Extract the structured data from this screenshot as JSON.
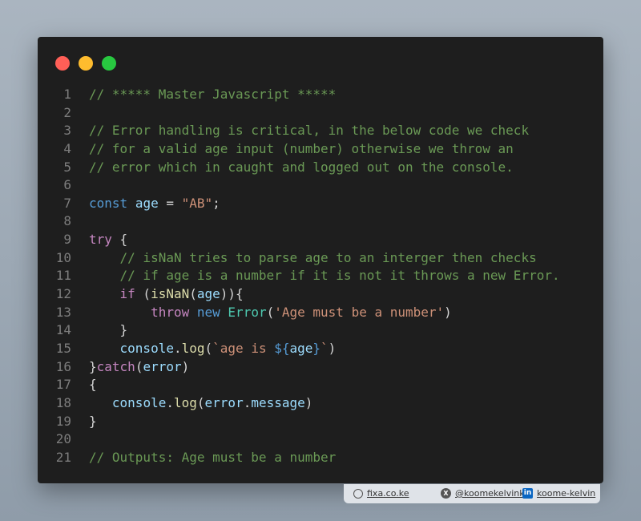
{
  "code_lines": [
    [
      {
        "t": "// ***** Master Javascript *****",
        "c": "c"
      }
    ],
    [],
    [
      {
        "t": "// Error handling is critical, in the below code we check",
        "c": "c"
      }
    ],
    [
      {
        "t": "// for a valid age input (number) otherwise we throw an",
        "c": "c"
      }
    ],
    [
      {
        "t": "// error which in caught and logged out on the console.",
        "c": "c"
      }
    ],
    [],
    [
      {
        "t": "const",
        "c": "k"
      },
      {
        "t": " "
      },
      {
        "t": "age",
        "c": "v"
      },
      {
        "t": " = "
      },
      {
        "t": "\"AB\"",
        "c": "s"
      },
      {
        "t": ";"
      }
    ],
    [],
    [
      {
        "t": "try",
        "c": "ctl"
      },
      {
        "t": " {"
      }
    ],
    [
      {
        "t": "    "
      },
      {
        "t": "// isNaN tries to parse age to an interger then checks",
        "c": "c"
      }
    ],
    [
      {
        "t": "    "
      },
      {
        "t": "// if age is a number if it is not it throws a new Error.",
        "c": "c"
      }
    ],
    [
      {
        "t": "    "
      },
      {
        "t": "if",
        "c": "ctl"
      },
      {
        "t": " ("
      },
      {
        "t": "isNaN",
        "c": "f"
      },
      {
        "t": "("
      },
      {
        "t": "age",
        "c": "v"
      },
      {
        "t": ")){"
      }
    ],
    [
      {
        "t": "        "
      },
      {
        "t": "throw",
        "c": "ctl"
      },
      {
        "t": " "
      },
      {
        "t": "new",
        "c": "k"
      },
      {
        "t": " "
      },
      {
        "t": "Error",
        "c": "t"
      },
      {
        "t": "("
      },
      {
        "t": "'Age must be a number'",
        "c": "s"
      },
      {
        "t": ")"
      }
    ],
    [
      {
        "t": "    }"
      }
    ],
    [
      {
        "t": "    "
      },
      {
        "t": "console",
        "c": "v"
      },
      {
        "t": "."
      },
      {
        "t": "log",
        "c": "f"
      },
      {
        "t": "("
      },
      {
        "t": "`age is ",
        "c": "s"
      },
      {
        "t": "${",
        "c": "k"
      },
      {
        "t": "age",
        "c": "v"
      },
      {
        "t": "}",
        "c": "k"
      },
      {
        "t": "`",
        "c": "s"
      },
      {
        "t": ")"
      }
    ],
    [
      {
        "t": "}"
      },
      {
        "t": "catch",
        "c": "ctl"
      },
      {
        "t": "("
      },
      {
        "t": "error",
        "c": "v"
      },
      {
        "t": ")"
      }
    ],
    [
      {
        "t": "{"
      }
    ],
    [
      {
        "t": "   "
      },
      {
        "t": "console",
        "c": "v"
      },
      {
        "t": "."
      },
      {
        "t": "log",
        "c": "f"
      },
      {
        "t": "("
      },
      {
        "t": "error",
        "c": "v"
      },
      {
        "t": "."
      },
      {
        "t": "message",
        "c": "v"
      },
      {
        "t": ")"
      }
    ],
    [
      {
        "t": "}"
      }
    ],
    [],
    [
      {
        "t": "// Outputs: Age must be a number",
        "c": "c"
      }
    ]
  ],
  "footer": {
    "website": "fixa.co.ke",
    "twitter": "@koomekelvink",
    "twitter_icon": "x-icon",
    "twitter_glyph": "X",
    "linkedin": "koome-kelvin",
    "linkedin_icon": "linkedin-icon",
    "linkedin_glyph": "in",
    "website_icon": "globe-icon"
  }
}
